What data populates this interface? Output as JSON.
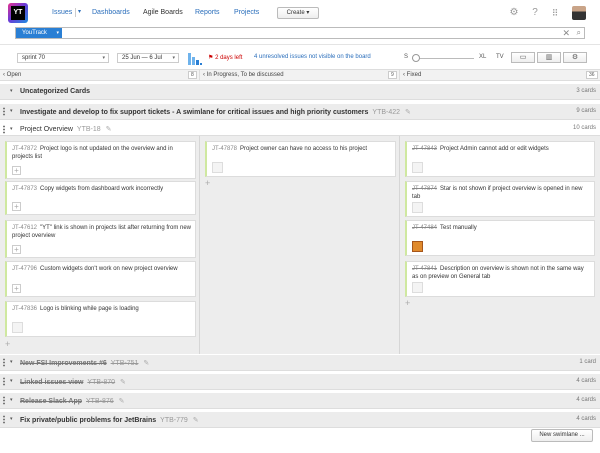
{
  "topbar": {
    "logo_text": "YT",
    "nav": [
      "Issues",
      "Dashboards",
      "Agile Boards",
      "Reports",
      "Projects"
    ],
    "nav_caret": "▾",
    "create_label": "Create",
    "create_caret": "▾",
    "icons": [
      "gear-icon",
      "help-icon",
      "apps-grid-icon",
      "user-avatar"
    ]
  },
  "search": {
    "context_label": "YouTrack",
    "context_caret": "▾",
    "query": "",
    "clear": "✕",
    "search_glyph": "⌕"
  },
  "toolbar": {
    "sprint": "sprint 70",
    "sprint_caret": "▾",
    "dates": "25 Jun — 6 Jul",
    "dates_caret": "▾",
    "days_left": "2 days left",
    "unresolved": "4 unresolved issues not visible on the board",
    "size_labels": [
      "S",
      "XL",
      "TV"
    ],
    "size_slider": 0.05,
    "view_buttons": [
      "tray-icon",
      "columns-icon",
      "settings-icon"
    ]
  },
  "columns": [
    {
      "name": "Open",
      "count": "8"
    },
    {
      "name": "In Progress, To be discussed",
      "count": "9"
    },
    {
      "name": "Fixed",
      "count": "36"
    }
  ],
  "swimlanes": {
    "uncategorized": {
      "title": "Uncategorized Cards",
      "count": "3 cards"
    },
    "investigate": {
      "title": "Investigate and develop to fix support tickets - A swimlane for critical issues and high priority customers",
      "id": "YTB-422",
      "count": "9 cards"
    },
    "overview": {
      "title": "Project Overview",
      "id": "YTB-18",
      "count": "10 cards"
    },
    "fsi": {
      "title": "New FSI Improvements #6",
      "id": "YTB-751",
      "count": "1 card"
    },
    "linked": {
      "title": "Linked issues view",
      "id": "YTB-870",
      "count": "4 cards"
    },
    "slack": {
      "title": "Release Slack App",
      "id": "YTB-876",
      "count": "4 cards"
    },
    "private": {
      "title": "Fix private/public problems for JetBrains",
      "id": "YTB-779",
      "count": "4 cards"
    }
  },
  "cards": {
    "open": [
      {
        "id": "JT-47872",
        "text": "Project logo is not updated on the overview and in projects list"
      },
      {
        "id": "JT-47873",
        "text": "Copy widgets from dashboard work incorrectly"
      },
      {
        "id": "JT-47612",
        "text": "\"YT\" link is shown in projects list after returning from new project overview"
      },
      {
        "id": "JT-47796",
        "text": "Custom widgets don't work on new project overview"
      },
      {
        "id": "JT-47836",
        "text": "Logo is blinking while page is loading"
      }
    ],
    "progress": [
      {
        "id": "JT-47878",
        "text": "Project owner can have no access to his project"
      }
    ],
    "fixed": [
      {
        "id": "JT-47843",
        "text": "Project Admin cannot add or edit widgets"
      },
      {
        "id": "JT-47874",
        "text": "Star is not shown if project overview is opened in new tab"
      },
      {
        "id": "JT-47484",
        "text": "Test manually"
      },
      {
        "id": "JT-47841",
        "text": "Description on overview is shown not in the same way as on preview on General tab"
      }
    ]
  },
  "new_swimlane_label": "New swimlane ...",
  "glyphs": {
    "expand": "▾",
    "collapse": "▸",
    "plus": "+",
    "pencil": "✎"
  },
  "colors": {
    "accent": "#2a7fd4",
    "card_stripe": "#cfe8a0",
    "danger": "#cc0000"
  }
}
